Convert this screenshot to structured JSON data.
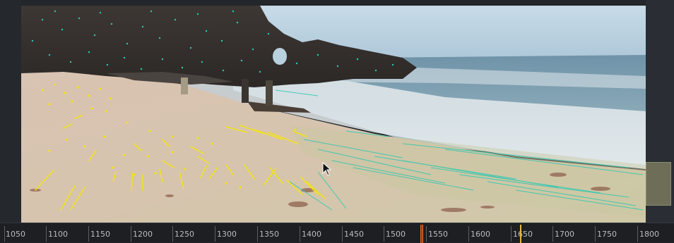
{
  "timeline": {
    "ticks": [
      "1050",
      "1100",
      "1150",
      "1200",
      "1250",
      "1300",
      "1350",
      "1400",
      "1450",
      "1500",
      "1550",
      "1600",
      "1650",
      "1700",
      "1750",
      "1800"
    ],
    "playhead_color": "#e06a2b",
    "marker_color": "#e5b83a"
  },
  "viewer": {
    "tracker_colors": {
      "active": "#f1e21b",
      "path": "#2cc8b0"
    },
    "icons": [
      "mouse-pointer-icon"
    ]
  }
}
